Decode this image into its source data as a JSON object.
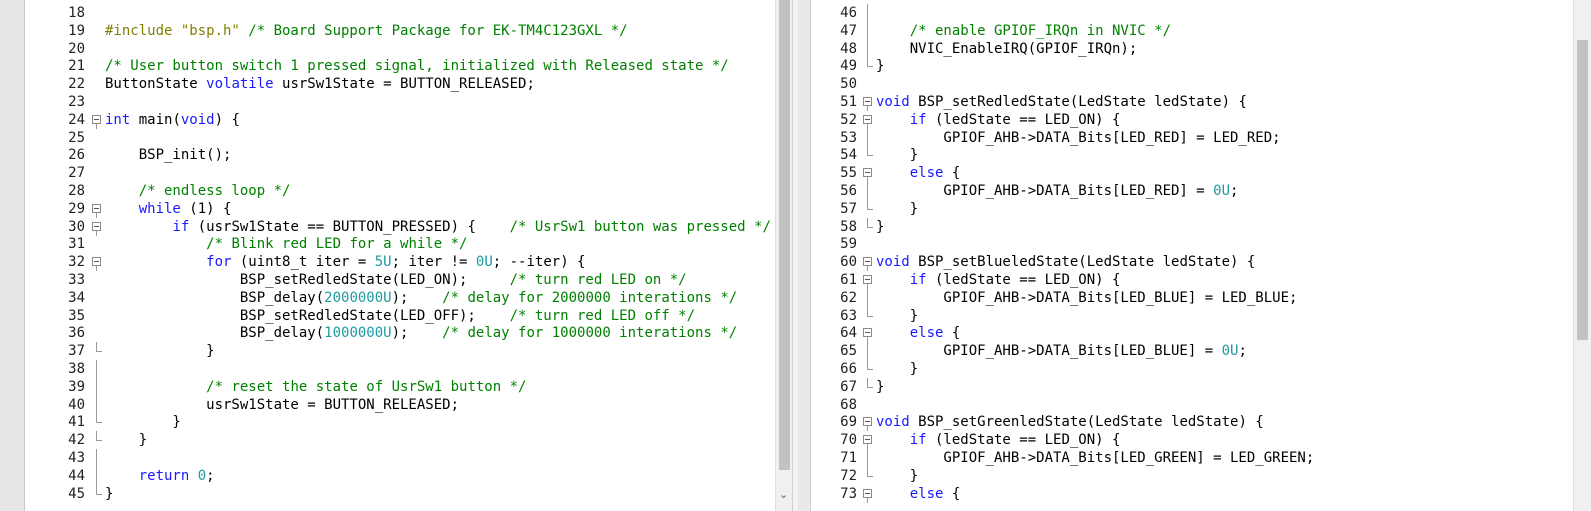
{
  "left_editor": {
    "lines": [
      {
        "num": "18",
        "segments": []
      },
      {
        "num": "19",
        "segments": [
          {
            "t": "#include \"bsp.h\"",
            "c": "pp"
          },
          {
            "t": " /* Board Support Package for EK-TM4C123GXL */",
            "c": "cm"
          }
        ]
      },
      {
        "num": "20",
        "segments": []
      },
      {
        "num": "21",
        "segments": [
          {
            "t": "/* User button switch 1 pressed signal, initialized with Released state */",
            "c": "cm"
          }
        ]
      },
      {
        "num": "22",
        "segments": [
          {
            "t": "ButtonState ",
            "c": ""
          },
          {
            "t": "volatile",
            "c": "kw"
          },
          {
            "t": " usrSw1State = BUTTON_RELEASED;",
            "c": ""
          }
        ]
      },
      {
        "num": "23",
        "segments": []
      },
      {
        "num": "24",
        "fold": "open",
        "segments": [
          {
            "t": "int",
            "c": "kw"
          },
          {
            "t": " main(",
            "c": ""
          },
          {
            "t": "void",
            "c": "kw"
          },
          {
            "t": ") {",
            "c": ""
          }
        ]
      },
      {
        "num": "25",
        "segments": []
      },
      {
        "num": "26",
        "segments": [
          {
            "t": "    BSP_init();",
            "c": ""
          }
        ]
      },
      {
        "num": "27",
        "segments": []
      },
      {
        "num": "28",
        "segments": [
          {
            "t": "    ",
            "c": ""
          },
          {
            "t": "/* endless loop */",
            "c": "cm"
          }
        ]
      },
      {
        "num": "29",
        "fold": "open",
        "segments": [
          {
            "t": "    ",
            "c": ""
          },
          {
            "t": "while",
            "c": "kw"
          },
          {
            "t": " (1) {",
            "c": ""
          }
        ]
      },
      {
        "num": "30",
        "fold": "open",
        "segments": [
          {
            "t": "        ",
            "c": ""
          },
          {
            "t": "if",
            "c": "kw"
          },
          {
            "t": " (usrSw1State == BUTTON_PRESSED) {    ",
            "c": ""
          },
          {
            "t": "/* UsrSw1 button was pressed */",
            "c": "cm"
          }
        ]
      },
      {
        "num": "31",
        "segments": [
          {
            "t": "            ",
            "c": ""
          },
          {
            "t": "/* Blink red LED for a while */",
            "c": "cm"
          }
        ]
      },
      {
        "num": "32",
        "fold": "open",
        "segments": [
          {
            "t": "            ",
            "c": ""
          },
          {
            "t": "for",
            "c": "kw"
          },
          {
            "t": " (uint8_t iter = ",
            "c": ""
          },
          {
            "t": "5U",
            "c": "num"
          },
          {
            "t": "; iter != ",
            "c": ""
          },
          {
            "t": "0U",
            "c": "num"
          },
          {
            "t": "; --iter) {",
            "c": ""
          }
        ]
      },
      {
        "num": "33",
        "segments": [
          {
            "t": "                BSP_setRedledState(LED_ON);     ",
            "c": ""
          },
          {
            "t": "/* turn red LED on */",
            "c": "cm"
          }
        ]
      },
      {
        "num": "34",
        "segments": [
          {
            "t": "                BSP_delay(",
            "c": ""
          },
          {
            "t": "2000000U",
            "c": "num"
          },
          {
            "t": ");    ",
            "c": ""
          },
          {
            "t": "/* delay for 2000000 interations */",
            "c": "cm"
          }
        ]
      },
      {
        "num": "35",
        "segments": [
          {
            "t": "                BSP_setRedledState(LED_OFF);    ",
            "c": ""
          },
          {
            "t": "/* turn red LED off */",
            "c": "cm"
          }
        ]
      },
      {
        "num": "36",
        "segments": [
          {
            "t": "                BSP_delay(",
            "c": ""
          },
          {
            "t": "1000000U",
            "c": "num"
          },
          {
            "t": ");    ",
            "c": ""
          },
          {
            "t": "/* delay for 1000000 interations */",
            "c": "cm"
          }
        ]
      },
      {
        "num": "37",
        "fold": "end",
        "segments": [
          {
            "t": "            }",
            "c": ""
          }
        ]
      },
      {
        "num": "38",
        "fold": "line",
        "segments": []
      },
      {
        "num": "39",
        "fold": "line",
        "segments": [
          {
            "t": "            ",
            "c": ""
          },
          {
            "t": "/* reset the state of UsrSw1 button */",
            "c": "cm"
          }
        ]
      },
      {
        "num": "40",
        "fold": "line",
        "segments": [
          {
            "t": "            usrSw1State = BUTTON_RELEASED;",
            "c": ""
          }
        ]
      },
      {
        "num": "41",
        "fold": "end",
        "segments": [
          {
            "t": "        }",
            "c": ""
          }
        ]
      },
      {
        "num": "42",
        "fold": "end",
        "segments": [
          {
            "t": "    }",
            "c": ""
          }
        ]
      },
      {
        "num": "43",
        "fold": "line",
        "segments": []
      },
      {
        "num": "44",
        "fold": "line",
        "segments": [
          {
            "t": "    ",
            "c": ""
          },
          {
            "t": "return",
            "c": "kw"
          },
          {
            "t": " ",
            "c": ""
          },
          {
            "t": "0",
            "c": "num"
          },
          {
            "t": ";",
            "c": ""
          }
        ]
      },
      {
        "num": "45",
        "fold": "end",
        "segments": [
          {
            "t": "}",
            "c": ""
          }
        ]
      }
    ]
  },
  "right_editor": {
    "lines": [
      {
        "num": "46",
        "fold": "line",
        "segments": []
      },
      {
        "num": "47",
        "fold": "line",
        "segments": [
          {
            "t": "    ",
            "c": ""
          },
          {
            "t": "/* enable GPIOF_IRQn in NVIC */",
            "c": "cm"
          }
        ]
      },
      {
        "num": "48",
        "fold": "line",
        "segments": [
          {
            "t": "    NVIC_EnableIRQ(GPIOF_IRQn);",
            "c": ""
          }
        ]
      },
      {
        "num": "49",
        "fold": "end",
        "segments": [
          {
            "t": "}",
            "c": ""
          }
        ]
      },
      {
        "num": "50",
        "segments": []
      },
      {
        "num": "51",
        "fold": "open",
        "segments": [
          {
            "t": "void",
            "c": "kw"
          },
          {
            "t": " BSP_setRedledState(LedState ledState) {",
            "c": ""
          }
        ]
      },
      {
        "num": "52",
        "fold": "open",
        "segments": [
          {
            "t": "    ",
            "c": ""
          },
          {
            "t": "if",
            "c": "kw"
          },
          {
            "t": " (ledState == LED_ON) {",
            "c": ""
          }
        ]
      },
      {
        "num": "53",
        "fold": "line",
        "segments": [
          {
            "t": "        GPIOF_AHB->DATA_Bits[LED_RED] = LED_RED;",
            "c": ""
          }
        ]
      },
      {
        "num": "54",
        "fold": "end",
        "segments": [
          {
            "t": "    }",
            "c": ""
          }
        ]
      },
      {
        "num": "55",
        "fold": "open",
        "segments": [
          {
            "t": "    ",
            "c": ""
          },
          {
            "t": "else",
            "c": "kw"
          },
          {
            "t": " {",
            "c": ""
          }
        ]
      },
      {
        "num": "56",
        "fold": "line",
        "segments": [
          {
            "t": "        GPIOF_AHB->DATA_Bits[LED_RED] = ",
            "c": ""
          },
          {
            "t": "0U",
            "c": "num"
          },
          {
            "t": ";",
            "c": ""
          }
        ]
      },
      {
        "num": "57",
        "fold": "end",
        "segments": [
          {
            "t": "    }",
            "c": ""
          }
        ]
      },
      {
        "num": "58",
        "fold": "end",
        "segments": [
          {
            "t": "}",
            "c": ""
          }
        ]
      },
      {
        "num": "59",
        "segments": []
      },
      {
        "num": "60",
        "fold": "open",
        "segments": [
          {
            "t": "void",
            "c": "kw"
          },
          {
            "t": " BSP_setBlueledState(LedState ledState) {",
            "c": ""
          }
        ]
      },
      {
        "num": "61",
        "fold": "open",
        "segments": [
          {
            "t": "    ",
            "c": ""
          },
          {
            "t": "if",
            "c": "kw"
          },
          {
            "t": " (ledState == LED_ON) {",
            "c": ""
          }
        ]
      },
      {
        "num": "62",
        "fold": "line",
        "segments": [
          {
            "t": "        GPIOF_AHB->DATA_Bits[LED_BLUE] = LED_BLUE;",
            "c": ""
          }
        ]
      },
      {
        "num": "63",
        "fold": "end",
        "segments": [
          {
            "t": "    }",
            "c": ""
          }
        ]
      },
      {
        "num": "64",
        "fold": "open",
        "segments": [
          {
            "t": "    ",
            "c": ""
          },
          {
            "t": "else",
            "c": "kw"
          },
          {
            "t": " {",
            "c": ""
          }
        ]
      },
      {
        "num": "65",
        "fold": "line",
        "segments": [
          {
            "t": "        GPIOF_AHB->DATA_Bits[LED_BLUE] = ",
            "c": ""
          },
          {
            "t": "0U",
            "c": "num"
          },
          {
            "t": ";",
            "c": ""
          }
        ]
      },
      {
        "num": "66",
        "fold": "end",
        "segments": [
          {
            "t": "    }",
            "c": ""
          }
        ]
      },
      {
        "num": "67",
        "fold": "end",
        "segments": [
          {
            "t": "}",
            "c": ""
          }
        ]
      },
      {
        "num": "68",
        "segments": []
      },
      {
        "num": "69",
        "fold": "open",
        "segments": [
          {
            "t": "void",
            "c": "kw"
          },
          {
            "t": " BSP_setGreenledState(LedState ledState) {",
            "c": ""
          }
        ]
      },
      {
        "num": "70",
        "fold": "open",
        "segments": [
          {
            "t": "    ",
            "c": ""
          },
          {
            "t": "if",
            "c": "kw"
          },
          {
            "t": " (ledState == LED_ON) {",
            "c": ""
          }
        ]
      },
      {
        "num": "71",
        "fold": "line",
        "segments": [
          {
            "t": "        GPIOF_AHB->DATA_Bits[LED_GREEN] = LED_GREEN;",
            "c": ""
          }
        ]
      },
      {
        "num": "72",
        "fold": "end",
        "segments": [
          {
            "t": "    }",
            "c": ""
          }
        ]
      },
      {
        "num": "73",
        "fold": "open",
        "segments": [
          {
            "t": "    ",
            "c": ""
          },
          {
            "t": "else",
            "c": "kw"
          },
          {
            "t": " {",
            "c": ""
          }
        ]
      }
    ]
  },
  "colors": {
    "keyword": "#1a1aff",
    "comment": "#008000",
    "preprocessor": "#808000",
    "number": "#1f9aa0"
  },
  "icons": {
    "scroll_down": "chevron-down-icon",
    "fold": "fold-minus-icon"
  }
}
